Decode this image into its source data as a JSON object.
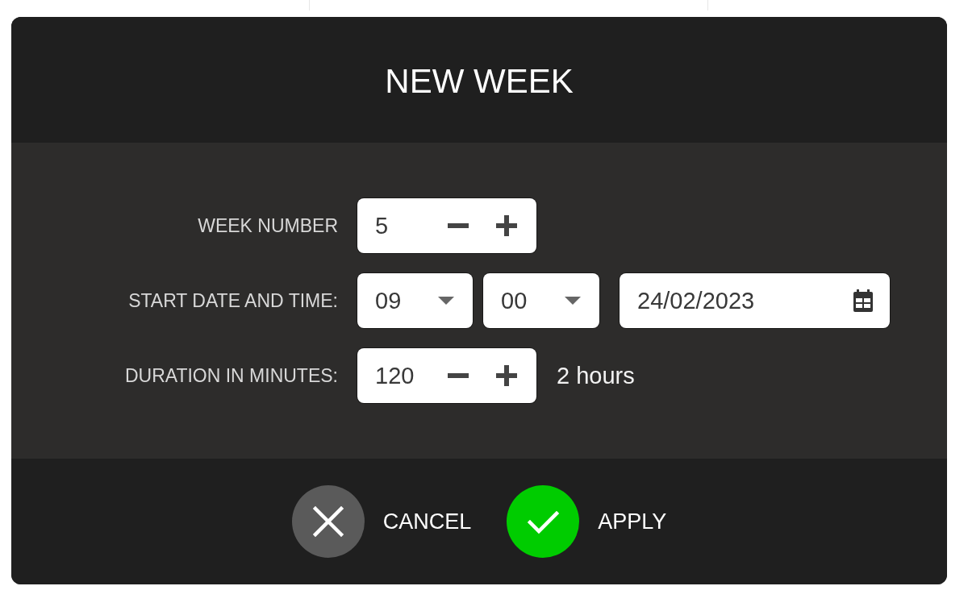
{
  "dialog": {
    "title": "NEW WEEK",
    "fields": [
      {
        "kind": "stepper",
        "label": "WEEK NUMBER",
        "value": "5"
      },
      {
        "kind": "datetime",
        "label": "START DATE AND TIME:",
        "hour": "09",
        "minute": "00",
        "date": "24/02/2023"
      },
      {
        "kind": "stepper",
        "label": "DURATION IN MINUTES:",
        "value": "120",
        "note": "2 hours"
      }
    ],
    "buttons": [
      {
        "kind": "cancel",
        "label": "CANCEL"
      },
      {
        "kind": "apply",
        "label": "APPLY"
      }
    ]
  }
}
